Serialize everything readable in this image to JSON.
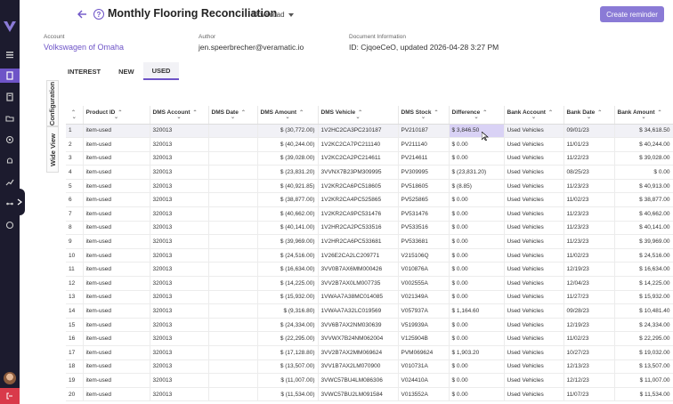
{
  "header": {
    "title": "Monthly Flooring Reconciliation",
    "download_label": "Download",
    "create_button": "Create reminder"
  },
  "meta": {
    "account_label": "Account",
    "account_value": "Volkswagen of Omaha",
    "author_label": "Author",
    "author_value": "jen.speerbrecher@veramatic.io",
    "docinfo_label": "Document Information",
    "docinfo_value": "ID: CjqoeCeO, updated 2026-04-28 3:27 PM"
  },
  "tabs": [
    "INTEREST",
    "NEW",
    "USED"
  ],
  "active_tab": "USED",
  "side_tabs": [
    "Configuration",
    "Wide View"
  ],
  "columns": [
    "",
    "Product ID",
    "DMS Account",
    "DMS Date",
    "DMS Amount",
    "DMS Vehicle",
    "DMS Stock",
    "Difference",
    "Bank Account",
    "Bank Date",
    "Bank Amount"
  ],
  "rows": [
    [
      "1",
      "item-used",
      "320013",
      "",
      "$ (30,772.00)",
      "1V2HC2CA3PC210187",
      "PV210187",
      "$ 3,846.50",
      "Used Vehicles",
      "09/01/23",
      "$ 34,618.50"
    ],
    [
      "2",
      "item-used",
      "320013",
      "",
      "$ (40,244.00)",
      "1V2KC2CA7PC211140",
      "PV211140",
      "$ 0.00",
      "Used Vehicles",
      "11/01/23",
      "$ 40,244.00"
    ],
    [
      "3",
      "item-used",
      "320013",
      "",
      "$ (39,028.00)",
      "1V2KC2CA2PC214611",
      "PV214611",
      "$ 0.00",
      "Used Vehicles",
      "11/22/23",
      "$ 39,028.00"
    ],
    [
      "4",
      "item-used",
      "320013",
      "",
      "$ (23,831.20)",
      "3VVNX7B23PM309995",
      "PV309995",
      "$ (23,831.20)",
      "Used Vehicles",
      "08/25/23",
      "$ 0.00"
    ],
    [
      "5",
      "item-used",
      "320013",
      "",
      "$ (40,921.85)",
      "1V2KR2CA6PC518605",
      "PV518605",
      "$ (8.85)",
      "Used Vehicles",
      "11/23/23",
      "$ 40,913.00"
    ],
    [
      "6",
      "item-used",
      "320013",
      "",
      "$ (38,877.00)",
      "1V2KR2CA4PC525865",
      "PV525865",
      "$ 0.00",
      "Used Vehicles",
      "11/02/23",
      "$ 38,877.00"
    ],
    [
      "7",
      "item-used",
      "320013",
      "",
      "$ (40,662.00)",
      "1V2KR2CA9PC531476",
      "PV531476",
      "$ 0.00",
      "Used Vehicles",
      "11/23/23",
      "$ 40,662.00"
    ],
    [
      "8",
      "item-used",
      "320013",
      "",
      "$ (40,141.00)",
      "1V2HR2CA2PC533516",
      "PV533516",
      "$ 0.00",
      "Used Vehicles",
      "11/23/23",
      "$ 40,141.00"
    ],
    [
      "9",
      "item-used",
      "320013",
      "",
      "$ (39,969.00)",
      "1V2HR2CA6PC533681",
      "PV533681",
      "$ 0.00",
      "Used Vehicles",
      "11/23/23",
      "$ 39,969.00"
    ],
    [
      "10",
      "item-used",
      "320013",
      "",
      "$ (24,516.00)",
      "1V26E2CA2LC209771",
      "V215106Q",
      "$ 0.00",
      "Used Vehicles",
      "11/02/23",
      "$ 24,516.00"
    ],
    [
      "11",
      "item-used",
      "320013",
      "",
      "$ (16,634.00)",
      "3VV0B7AX6MM000426",
      "V010876A",
      "$ 0.00",
      "Used Vehicles",
      "12/19/23",
      "$ 16,634.00"
    ],
    [
      "12",
      "item-used",
      "320013",
      "",
      "$ (14,225.00)",
      "3VV2B7AX0LM007735",
      "V002555A",
      "$ 0.00",
      "Used Vehicles",
      "12/04/23",
      "$ 14,225.00"
    ],
    [
      "13",
      "item-used",
      "320013",
      "",
      "$ (15,932.00)",
      "1VWAA7A38MC014085",
      "V021349A",
      "$ 0.00",
      "Used Vehicles",
      "11/27/23",
      "$ 15,932.00"
    ],
    [
      "14",
      "item-used",
      "320013",
      "",
      "$ (9,316.80)",
      "1VWAA7A32LC019569",
      "V057937A",
      "$ 1,164.60",
      "Used Vehicles",
      "09/28/23",
      "$ 10,481.40"
    ],
    [
      "15",
      "item-used",
      "320013",
      "",
      "$ (24,334.00)",
      "3VV6B7AX2NM030639",
      "V519939A",
      "$ 0.00",
      "Used Vehicles",
      "12/19/23",
      "$ 24,334.00"
    ],
    [
      "16",
      "item-used",
      "320013",
      "",
      "$ (22,295.00)",
      "3VVWX7B24NM062004",
      "V125904B",
      "$ 0.00",
      "Used Vehicles",
      "11/02/23",
      "$ 22,295.00"
    ],
    [
      "17",
      "item-used",
      "320013",
      "",
      "$ (17,128.80)",
      "3VV2B7AX2MM069624",
      "PVM069624",
      "$ 1,903.20",
      "Used Vehicles",
      "10/27/23",
      "$ 19,032.00"
    ],
    [
      "18",
      "item-used",
      "320013",
      "",
      "$ (13,507.00)",
      "3VV1B7AX2LM070900",
      "V010731A",
      "$ 0.00",
      "Used Vehicles",
      "12/13/23",
      "$ 13,507.00"
    ],
    [
      "19",
      "item-used",
      "320013",
      "",
      "$ (11,007.00)",
      "3VWC57BU4LM086306",
      "V024410A",
      "$ 0.00",
      "Used Vehicles",
      "12/12/23",
      "$ 11,007.00"
    ],
    [
      "20",
      "item-used",
      "320013",
      "",
      "$ (11,534.00)",
      "3VWC57BU2LM091584",
      "V013552A",
      "$ 0.00",
      "Used Vehicles",
      "11/07/23",
      "$ 11,534.00"
    ]
  ],
  "colors": {
    "accent": "#6e54c7",
    "rail": "#1c1b2e",
    "button": "#8a7ad6",
    "logout": "#d93a4a",
    "highlight": "#d9d2f5"
  }
}
